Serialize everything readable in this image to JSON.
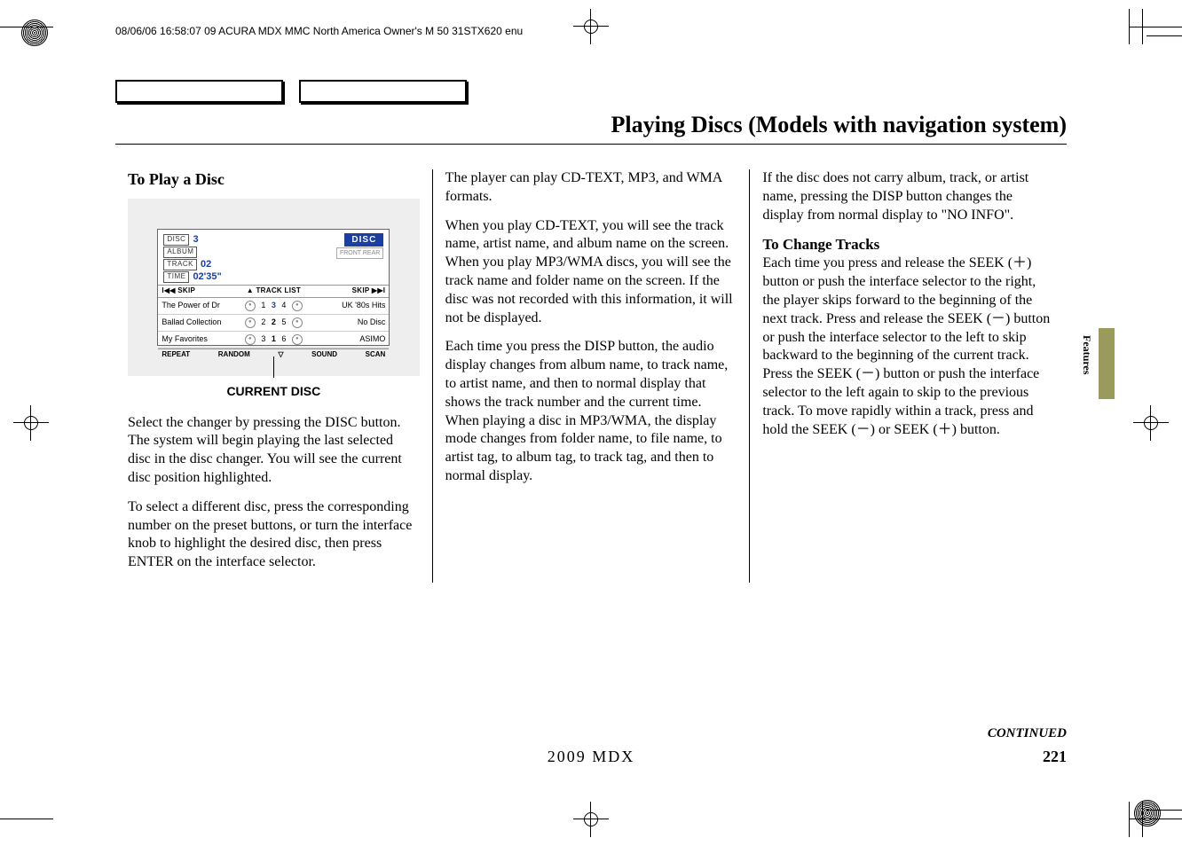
{
  "header": "08/06/06 16:58:07   09 ACURA MDX MMC North America Owner's M 50 31STX620 enu",
  "page_title": "Playing Discs (Models with navigation system)",
  "side_label": "Features",
  "continued": "CONTINUED",
  "page_number": "221",
  "footer_model": "2009  MDX",
  "figure_caption": "CURRENT DISC",
  "audio": {
    "disc_label": "DISC",
    "album_label": "ALBUM",
    "track_label": "TRACK",
    "time_label": "TIME",
    "disc_num": "3",
    "track_num": "02",
    "time_val": "02'35\"",
    "badge": "DISC",
    "front_rear": "FRONT  REAR",
    "bar_left": "I◀◀ SKIP",
    "bar_mid": "▲ TRACK LIST",
    "bar_right": "SKIP ▶▶I",
    "rows": [
      {
        "l": "The Power of  Dr",
        "ln": "1",
        "lh": "3",
        "r": "UK '80s Hits",
        "rn": "4"
      },
      {
        "l": "Ballad Collection",
        "ln": "2",
        "lh": "2",
        "r": "No Disc",
        "rn": "5"
      },
      {
        "l": "My Favorites",
        "ln": "3",
        "lh": "1",
        "r": "ASIMO",
        "rn": "6"
      }
    ],
    "bottom": [
      "REPEAT",
      "RANDOM",
      "▽",
      "SOUND",
      "SCAN"
    ]
  },
  "col1": {
    "h": "To Play a Disc",
    "p1": "Select the changer by pressing the DISC button. The system will begin playing the last selected disc in the disc changer. You will see the current disc position highlighted.",
    "p2": "To select a different disc, press the corresponding number on the preset buttons, or turn the interface knob to highlight the desired disc, then press ENTER on the interface selector."
  },
  "col2": {
    "p1": "The player can play CD-TEXT, MP3, and WMA formats.",
    "p2": "When you play CD-TEXT, you will see the track name, artist name, and album name on the screen. When you play MP3/WMA discs, you will see the track name and folder name on the screen. If the disc was not recorded with this information, it will not be displayed.",
    "p3": "Each time you press the DISP button, the audio display changes from album name, to track name, to artist name, and then to normal display that shows the track number and the current time. When playing a disc in MP3/WMA, the display mode changes from folder name, to file name, to artist tag, to album tag, to track tag, and then to normal display."
  },
  "col3": {
    "p1": "If the disc does not carry album, track, or artist name, pressing the DISP button changes the display from normal display to \"NO INFO\".",
    "h": "To Change Tracks",
    "p2": "Each time you press and release the SEEK (＋) button or push the interface selector to the right, the player skips forward to the beginning of the next track. Press and release the SEEK (－) button or push the interface selector to the left to skip backward to the beginning of the current track. Press the SEEK (－) button or push the interface selector to the left again to skip to the previous track. To move rapidly within a track, press and hold the SEEK (－) or SEEK (＋) button."
  }
}
